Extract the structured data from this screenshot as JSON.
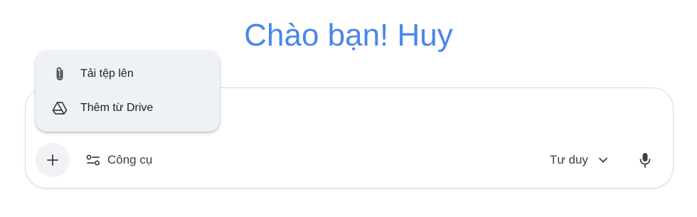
{
  "greeting": "Chào bạn! Huy",
  "menu": {
    "items": [
      {
        "label": "Tải tệp lên",
        "icon": "paperclip-icon"
      },
      {
        "label": "Thêm từ Drive",
        "icon": "drive-icon"
      }
    ]
  },
  "toolbar": {
    "add_icon": "plus-icon",
    "tools_label": "Công cụ",
    "tools_icon": "tune-icon",
    "mode_label": "Tư duy",
    "mode_icon": "chevron-down-icon",
    "mic_icon": "microphone-icon"
  },
  "colors": {
    "greeting": "#4a86e8",
    "menu_background": "#eef1f6",
    "icon": "#3c4043"
  }
}
